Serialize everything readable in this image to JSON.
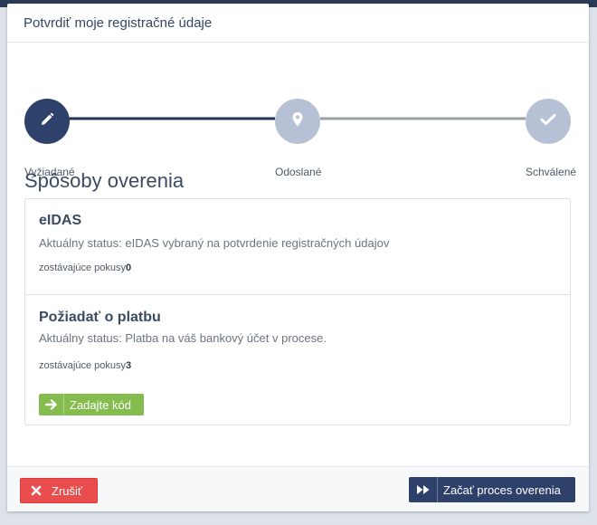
{
  "modal": {
    "title": "Potvrdiť moje registračné údaje"
  },
  "steps": [
    {
      "label": "Vyžiadané",
      "icon": "pencil-icon",
      "state": "active"
    },
    {
      "label": "Odoslané",
      "icon": "location-pin-icon",
      "state": "inactive"
    },
    {
      "label": "Schválené",
      "icon": "checkmark-icon",
      "state": "inactive"
    }
  ],
  "section_title": "Spôsoby overenia",
  "methods": [
    {
      "name": "eIDAS",
      "status": "Aktuálny status: eIDAS vybraný na potvrdenie registračných údajov",
      "attempts_label": "zostávajúce pokusy",
      "attempts": "0"
    },
    {
      "name": "Požiadať o platbu",
      "status": "Aktuálny status: Platba na váš bankový účet v procese.",
      "attempts_label": "zostávajúce pokusy",
      "attempts": "3",
      "action_label": "Zadajte kód",
      "action_icon": "arrow-right-icon"
    }
  ],
  "footer": {
    "cancel_label": "Zrušiť",
    "cancel_icon": "close-icon",
    "start_label": "Začať proces overenia",
    "start_icon": "fast-forward-icon"
  },
  "colors": {
    "primary": "#2d416a",
    "inactive_step": "#b7c1d5",
    "success": "#84bc4e",
    "danger": "#ea4d4d"
  }
}
